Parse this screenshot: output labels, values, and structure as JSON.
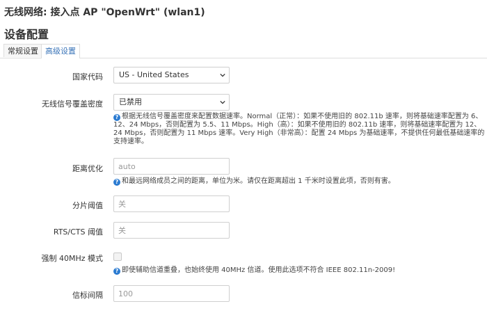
{
  "header": {
    "page_title": "无线网络: 接入点 AP \"OpenWrt\" (wlan1)",
    "section_title": "设备配置"
  },
  "tabs": [
    {
      "label": "常规设置",
      "active": false
    },
    {
      "label": "高级设置",
      "active": true
    }
  ],
  "form": {
    "country": {
      "label": "国家代码",
      "value": "US - United States"
    },
    "coverage": {
      "label": "无线信号覆盖密度",
      "value": "已禁用",
      "hint": "根据无线信号覆盖密度来配置数据速率。Normal（正常）：如果不使用旧的 802.11b 速率，则将基础速率配置为 6、12、24 Mbps，否则配置为 5.5、11 Mbps。High（高）：如果不使用旧的 802.11b 速率，则将基础速率配置为 12、24 Mbps，否则配置为 11 Mbps 速率。Very High（非常高）：配置 24 Mbps 为基础速率，不提供任何最低基础速率的支持速率。"
    },
    "distance": {
      "label": "距离优化",
      "placeholder": "auto",
      "hint": "和最远网络成员之间的距离，单位为米。请仅在距离超出 1 千米时设置此项，否则有害。"
    },
    "frag": {
      "label": "分片阈值",
      "placeholder": "关"
    },
    "rts": {
      "label": "RTS/CTS 阈值",
      "placeholder": "关"
    },
    "force40": {
      "label": "强制 40MHz 模式",
      "checked": false,
      "hint": "即使辅助信道重叠，也始终使用 40MHz 信道。使用此选项不符合 IEEE 802.11n-2009!"
    },
    "beacon": {
      "label": "信标间隔",
      "placeholder": "100"
    }
  },
  "colors": {
    "accent": "#3a74b8",
    "help_icon": "#2b7bd1",
    "border": "#cfcfcf"
  },
  "icons": {
    "help": "help-circle-icon",
    "chevron": "chevron-down-icon"
  }
}
